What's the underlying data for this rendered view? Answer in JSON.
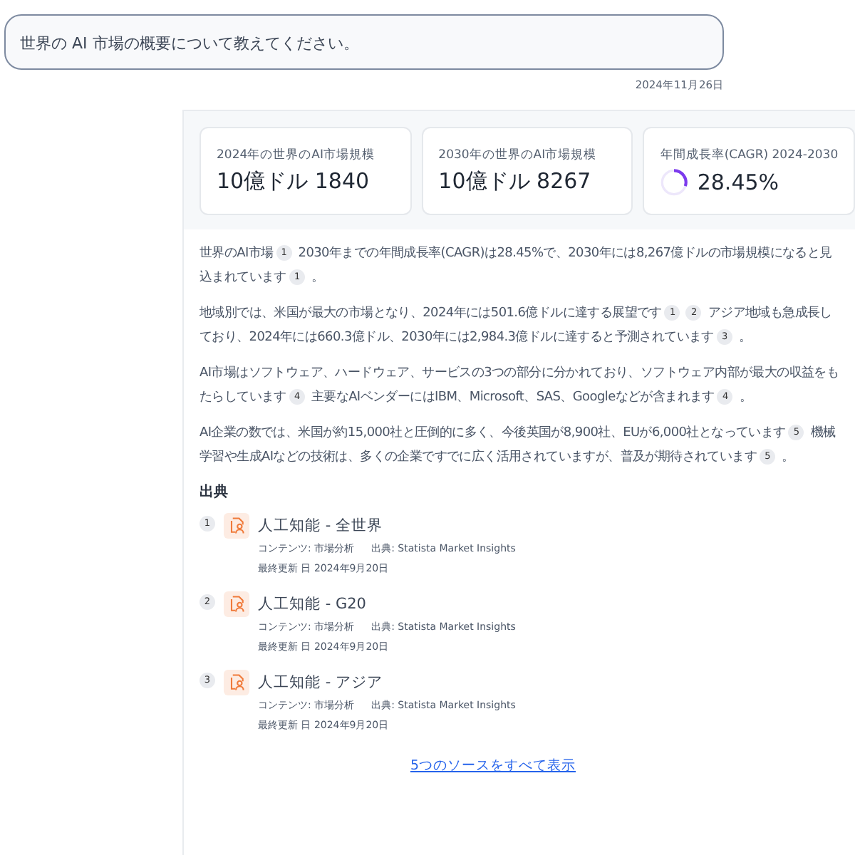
{
  "question": {
    "text": "世界の AI 市場の概要について教えてください。",
    "date": "2024年11月26日"
  },
  "stats": [
    {
      "kind": "value",
      "label": "2024年の世界のAI市場規模",
      "value": "10億ドル 1840"
    },
    {
      "kind": "value",
      "label": "2030年の世界のAI市場規模",
      "value": "10億ドル 8267"
    },
    {
      "kind": "ring",
      "label": "年間成長率(CAGR) 2024-2030",
      "value": "28.45%"
    }
  ],
  "paragraphs": [
    [
      {
        "text": "世界のAI市場"
      },
      {
        "cite": "1"
      },
      {
        "text": " 2030年までの年間成長率(CAGR)は28.45%で、2030年には8,267億ドルの市場規模になると見込まれています"
      },
      {
        "cite": "1"
      },
      {
        "text": " 。"
      }
    ],
    [
      {
        "text": "地域別では、米国が最大の市場となり、2024年には501.6億ドルに達する展望です"
      },
      {
        "cite": "1"
      },
      {
        "cite": "2"
      },
      {
        "text": " アジア地域も急成長しており、2024年には660.3億ドル、2030年には2,984.3億ドルに達すると予測されています"
      },
      {
        "cite": "3"
      },
      {
        "text": " 。"
      }
    ],
    [
      {
        "text": "AI市場はソフトウェア、ハードウェア、サービスの3つの部分に分かれており、ソフトウェア内部が最大の収益をもたらしています"
      },
      {
        "cite": "4"
      },
      {
        "text": " 主要なAIベンダーにはIBM、Microsoft、SAS、Googleなどが含まれます"
      },
      {
        "cite": "4"
      },
      {
        "text": " 。"
      }
    ],
    [
      {
        "text": "AI企業の数では、米国が約15,000社と圧倒的に多く、今後英国が8,900社、EUが6,000社となっています"
      },
      {
        "cite": "5"
      },
      {
        "text": " 機械学習や生成AIなどの技術は、多くの企業ですでに広く活用されていますが、普及が期待されています"
      },
      {
        "cite": "5"
      },
      {
        "text": " 。"
      }
    ]
  ],
  "sources": {
    "heading": "出典",
    "items": [
      {
        "number": "1",
        "title": "人工知能 - 全世界",
        "content": "コンテンツ: 市場分析",
        "source": "出典: Statista Market Insights",
        "updated": "最終更新 日 2024年9月20日"
      },
      {
        "number": "2",
        "title": "人工知能 - G20",
        "content": "コンテンツ: 市場分析",
        "source": "出典: Statista Market Insights",
        "updated": "最終更新 日 2024年9月20日"
      },
      {
        "number": "3",
        "title": "人工知能 - アジア",
        "content": "コンテンツ: 市場分析",
        "source": "出典: Statista Market Insights",
        "updated": "最終更新 日 2024年9月20日"
      }
    ],
    "show_all": "5つのソースをすべて表示"
  }
}
